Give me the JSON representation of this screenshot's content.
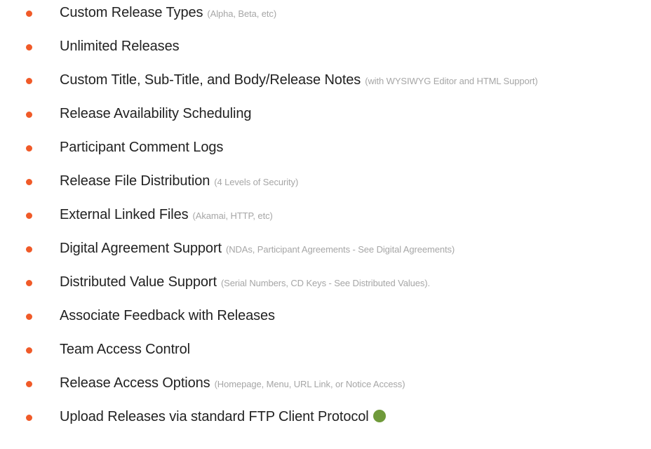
{
  "features": [
    {
      "title": "Custom Release Types",
      "note": "(Alpha, Beta, etc)"
    },
    {
      "title": "Unlimited Releases",
      "note": ""
    },
    {
      "title": "Custom Title, Sub-Title, and Body/Release Notes",
      "note": "(with WYSIWYG Editor and HTML Support)"
    },
    {
      "title": "Release Availability Scheduling",
      "note": ""
    },
    {
      "title": "Participant Comment Logs",
      "note": ""
    },
    {
      "title": "Release File Distribution",
      "note": "(4 Levels of Security)"
    },
    {
      "title": "External Linked Files",
      "note": "(Akamai, HTTP, etc)"
    },
    {
      "title": "Digital Agreement Support",
      "note": "(NDAs, Participant Agreements - See Digital Agreements)"
    },
    {
      "title": "Distributed Value Support",
      "note": "(Serial Numbers, CD Keys - See Distributed Values)."
    },
    {
      "title": "Associate Feedback with Releases",
      "note": ""
    },
    {
      "title": "Team Access Control",
      "note": ""
    },
    {
      "title": "Release Access Options",
      "note": "(Homepage, Menu, URL Link, or Notice Access)"
    },
    {
      "title": "Upload Releases via standard FTP Client Protocol",
      "note": ""
    }
  ],
  "colors": {
    "bullet": "#f05a28",
    "status_dot": "#6f9a3a",
    "title_text": "#222222",
    "note_text": "#a6a6a6"
  },
  "status_icon": "green-circle-icon"
}
